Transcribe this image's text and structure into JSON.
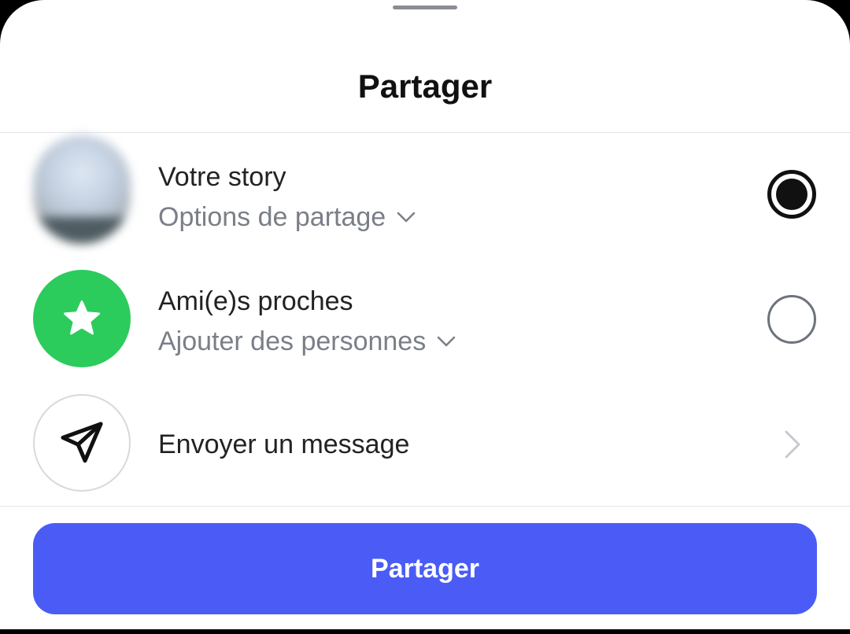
{
  "sheet": {
    "title": "Partager"
  },
  "options": {
    "story": {
      "title": "Votre story",
      "subtitle": "Options de partage",
      "selected": true
    },
    "close_friends": {
      "title": "Ami(e)s proches",
      "subtitle": "Ajouter des personnes",
      "selected": false,
      "icon": "star-icon"
    },
    "message": {
      "title": "Envoyer un message",
      "icon": "send-icon"
    }
  },
  "actions": {
    "share_label": "Partager"
  },
  "colors": {
    "accent": "#4a5cf5",
    "close_friends_green": "#2bcc5c",
    "subtitle_gray": "#7a7f87"
  }
}
